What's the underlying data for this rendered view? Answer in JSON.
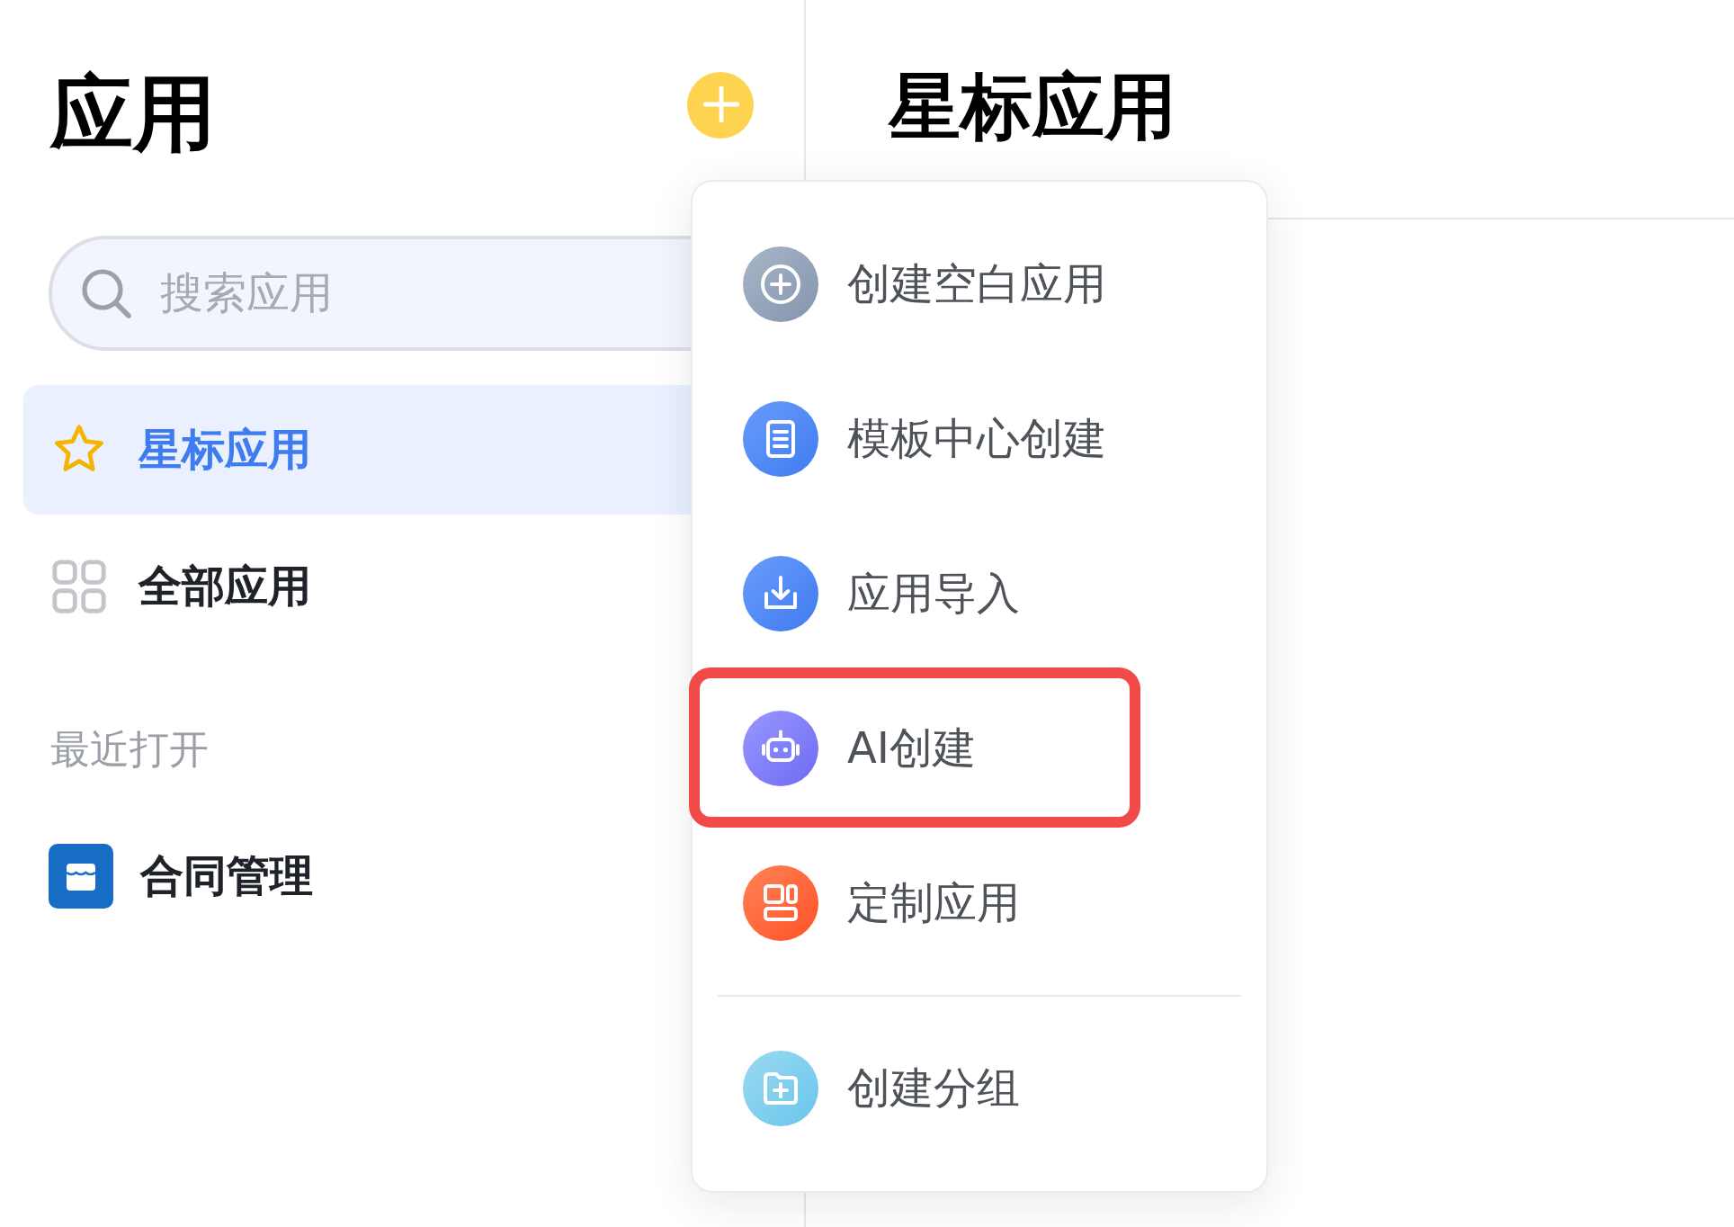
{
  "sidebar": {
    "title": "应用",
    "search": {
      "placeholder": "搜索应用"
    },
    "nav_items": [
      {
        "label": "星标应用",
        "selected": true
      },
      {
        "label": "全部应用",
        "selected": false
      }
    ],
    "recent": {
      "heading": "最近打开",
      "items": [
        {
          "label": "合同管理"
        }
      ]
    }
  },
  "main": {
    "title": "星标应用"
  },
  "menu": {
    "groups": [
      {
        "items": [
          {
            "label": "创建空白应用",
            "highlighted": false
          },
          {
            "label": "模板中心创建",
            "highlighted": false
          },
          {
            "label": "应用导入",
            "highlighted": false
          },
          {
            "label": "AI创建",
            "highlighted": true
          },
          {
            "label": "定制应用",
            "highlighted": false
          }
        ]
      },
      {
        "items": [
          {
            "label": "创建分组",
            "highlighted": false
          }
        ]
      }
    ]
  }
}
